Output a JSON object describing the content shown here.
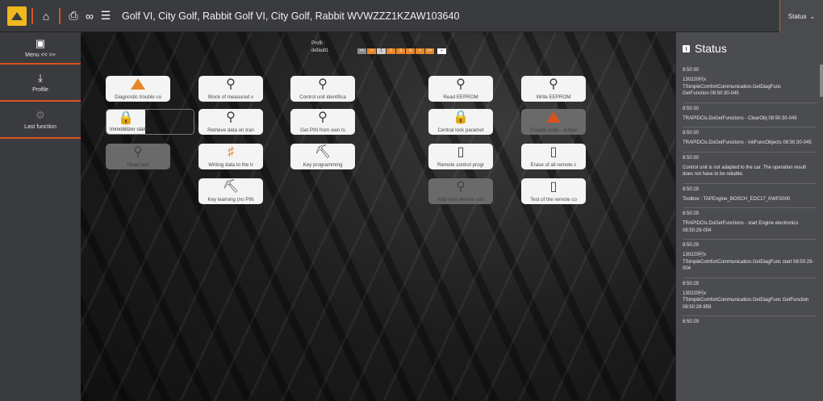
{
  "topbar": {
    "vehicle_title": "Golf VI, City Golf, Rabbit Golf VI, City Golf, Rabbit WVWZZZ1KZAW103640",
    "status_label": "Status",
    "icons": [
      "home-icon",
      "print-icon",
      "link-icon",
      "list-icon"
    ]
  },
  "sidebar": {
    "menu_label": "Menu << >>",
    "profile_label": "Profile",
    "last_function_label": "Last function"
  },
  "workspace": {
    "profil_label": "Profil :",
    "profil_value": "default1",
    "pager": [
      "<<",
      "<",
      "1",
      "2",
      "3",
      "4",
      ">",
      ">>"
    ],
    "tiles": [
      {
        "label": "Diagnostic trouble co",
        "icon": "warning-icon"
      },
      {
        "label": "Block of measured v",
        "icon": "wrench-icon"
      },
      {
        "label": "Control unit identifica",
        "icon": "wrench-icon"
      },
      {
        "label": "Read EEPROM",
        "icon": "wrench-icon"
      },
      {
        "label": "Write EEPROM",
        "icon": "wrench-icon"
      },
      {
        "label": "Immobilizer status",
        "icon": "lock-icon"
      },
      {
        "label": "Retrieve data on tran",
        "icon": "wrench-icon"
      },
      {
        "label": "Get PIN from own ts",
        "icon": "wrench-icon"
      },
      {
        "label": "Central lock paramet",
        "icon": "lock-icon"
      },
      {
        "label": "Trouble code - remov",
        "icon": "warning-icon"
      },
      {
        "label": "Head unit",
        "icon": "wrench-icon"
      },
      {
        "label": "Writing data to the tr",
        "icon": "key-icon"
      },
      {
        "label": "Key programming",
        "icon": "key-icon"
      },
      {
        "label": "Remote control progr",
        "icon": "remote-icon"
      },
      {
        "label": "Erase of all remote c",
        "icon": "remote-icon"
      },
      {
        "label": "Key learning (no PIN",
        "icon": "key-icon"
      },
      {
        "label": "Add next remote con",
        "icon": "wrench-icon"
      },
      {
        "label": "Test of the remote co",
        "icon": "remote-icon"
      }
    ]
  },
  "status_panel": {
    "title": "Status",
    "entries": [
      {
        "time": "8:50:30",
        "msg": "130220\u0019x\nTSimpleComfortCommunication.GetDiagFunc\nGetFunction 08:50:30-045"
      },
      {
        "time": "8:50:30",
        "msg": "TRAPIDCls.DoGetFunctions - ClearObj 08:50:30-045"
      },
      {
        "time": "8:50:30",
        "msg": "TRAPIDCls.DoGetFunctions - InitFuncObjects 08:50:30-045"
      },
      {
        "time": "8:50:30",
        "msg": "Control unit is not adapted to the car. The operation result does not have to be reliable."
      },
      {
        "time": "8:50:29",
        "msg": "Toolbox : TAPEngine_BOSCH_EDC17_KWP2000"
      },
      {
        "time": "8:50:29",
        "msg": "TRAPIDCls.DoGetFunctions - start Engine electronics 08:50:29-004"
      },
      {
        "time": "8:50:29",
        "msg": "130220\u0019x\nTSimpleComfortCommunication.GetDiagFunc start 08:50:29-004"
      },
      {
        "time": "8:50:29",
        "msg": "130220\u0019x\nTSimpleComfortCommunication.GetDiagFunc GetFunction 08:50:28-959"
      },
      {
        "time": "8:50:29",
        "msg": ""
      }
    ]
  },
  "colors": {
    "accent": "#e8882a",
    "topbar_bg": "#3a3b3e",
    "panel_bg": "#4b4c50"
  }
}
